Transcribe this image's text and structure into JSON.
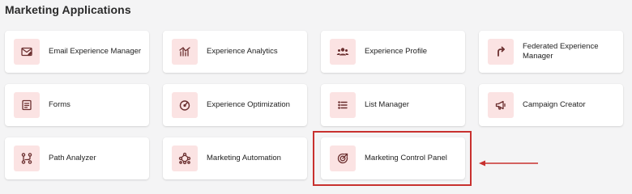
{
  "section": {
    "title": "Marketing Applications"
  },
  "tiles": [
    {
      "label": "Email Experience Manager",
      "icon": "email-icon"
    },
    {
      "label": "Experience Analytics",
      "icon": "analytics-icon"
    },
    {
      "label": "Experience Profile",
      "icon": "profile-icon"
    },
    {
      "label": "Federated Experience Manager",
      "icon": "federated-icon"
    },
    {
      "label": "Forms",
      "icon": "forms-icon"
    },
    {
      "label": "Experience Optimization",
      "icon": "optimization-icon"
    },
    {
      "label": "List Manager",
      "icon": "list-icon"
    },
    {
      "label": "Campaign Creator",
      "icon": "megaphone-icon"
    },
    {
      "label": "Path Analyzer",
      "icon": "path-icon"
    },
    {
      "label": "Marketing Automation",
      "icon": "automation-icon"
    },
    {
      "label": "Marketing Control Panel",
      "icon": "target-icon"
    }
  ],
  "annotation": {
    "highlighted_tile": "Marketing Control Panel",
    "highlight_color": "#c8312f"
  },
  "colors": {
    "icon_bg": "#fbe3e3",
    "icon_fg": "#6b2f2f",
    "tile_bg": "#ffffff",
    "page_bg": "#f4f4f5"
  }
}
